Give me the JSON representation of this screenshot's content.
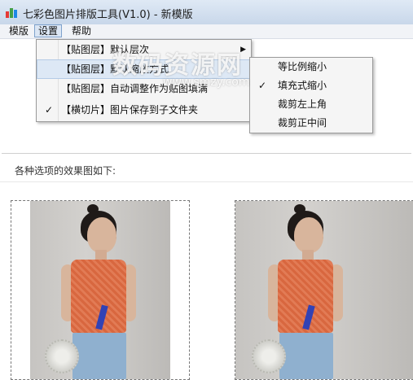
{
  "window": {
    "title": "七彩色图片排版工具(V1.0) - 新模版"
  },
  "menubar": {
    "items": [
      "模版",
      "设置",
      "帮助"
    ]
  },
  "settings_menu": {
    "items": [
      {
        "label": "【贴图层】默认层次",
        "has_submenu": true,
        "checked": false
      },
      {
        "label": "【贴图层】默认缩放方式",
        "has_submenu": false,
        "checked": false
      },
      {
        "label": "【贴图层】自动调整作为贴图填满",
        "has_submenu": false,
        "checked": false
      },
      {
        "label": "【横切片】图片保存到子文件夹",
        "has_submenu": false,
        "checked": true
      }
    ]
  },
  "scale_submenu": {
    "items": [
      {
        "label": "等比例缩小",
        "checked": false
      },
      {
        "label": "填充式缩小",
        "checked": true
      },
      {
        "label": "裁剪左上角",
        "checked": false
      },
      {
        "label": "裁剪正中间",
        "checked": false
      }
    ]
  },
  "watermark": {
    "text": "数码资源网",
    "url": "www.smzy.com"
  },
  "content": {
    "caption": "各种选项的效果图如下:"
  },
  "icons": {
    "check": "✓",
    "submenu_arrow": "▶"
  }
}
